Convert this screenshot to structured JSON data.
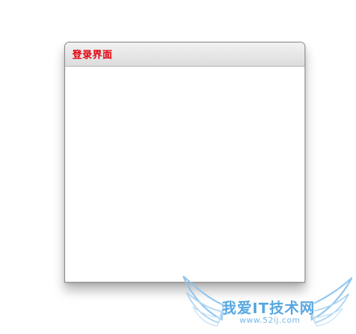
{
  "window": {
    "title": "登录界面"
  },
  "watermark": {
    "text": "我爱IT技术网",
    "url": "www.52ij.com",
    "color": "#4fa3e0"
  },
  "colors": {
    "title": "#e3000f",
    "header_top": "#f2f2f2",
    "header_bottom": "#dcdcdc",
    "border": "#8f8f8f"
  }
}
